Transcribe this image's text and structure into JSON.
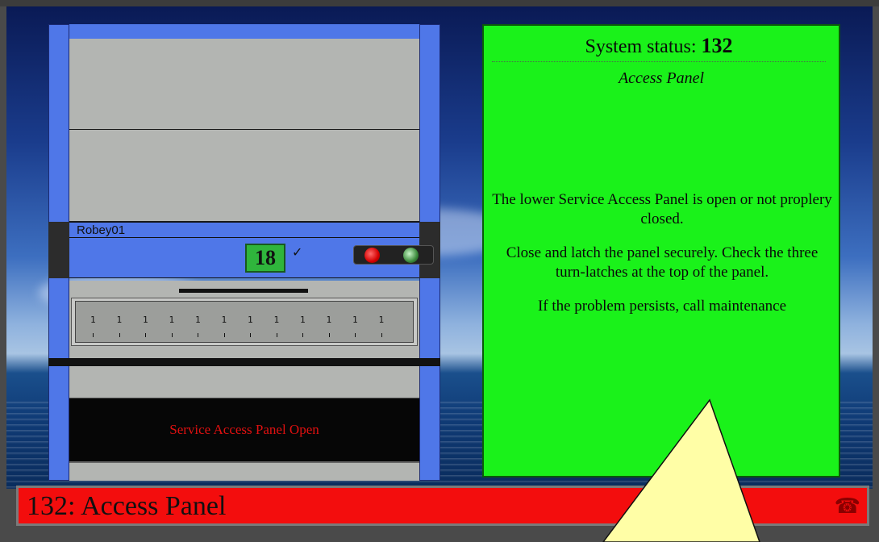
{
  "machine": {
    "name_label": "Robey01",
    "counter_value": "18",
    "check_mark": "✓",
    "panel_status_text": "Service Access Panel Open",
    "drawer_tick_labels": [
      "1",
      "1",
      "1",
      "1",
      "1",
      "1",
      "1",
      "1",
      "1",
      "1",
      "1",
      "1"
    ]
  },
  "status_panel": {
    "title_prefix": "System status:",
    "status_code": "132",
    "subtitle": "Access Panel",
    "message_line1": "The lower Service Access Panel is open or not proplery closed.",
    "message_line2": "Close and latch the panel securely. Check the three turn-latches at the top of the panel.",
    "message_line3": "If the problem persists, call maintenance"
  },
  "alarm_bar": {
    "code": "132",
    "separator": ":",
    "text": "Access Panel",
    "phone_icon": "phone-icon"
  },
  "colors": {
    "status_green": "#1af21a",
    "alarm_red": "#f30d0d",
    "machine_blue": "#4f77e8",
    "callout_yellow": "#fffea6"
  }
}
